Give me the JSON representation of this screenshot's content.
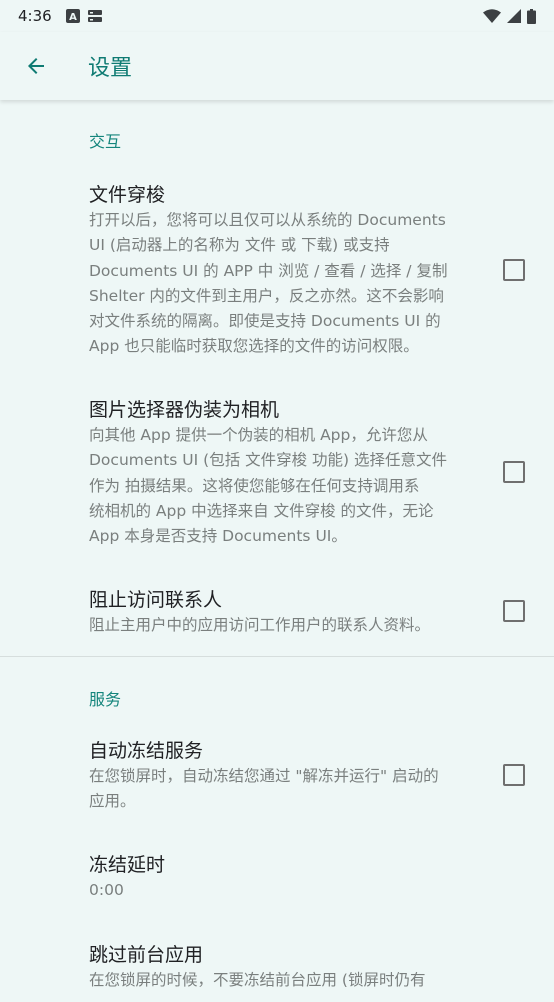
{
  "status_bar": {
    "time": "4:36",
    "icons": [
      "a-icon",
      "sim-card-icon",
      "wifi-icon",
      "signal-icon",
      "battery-icon"
    ]
  },
  "app_bar": {
    "back_icon": "arrow-left-icon",
    "title": "设置"
  },
  "colors": {
    "accent": "#14857c",
    "background": "#eef7f6"
  },
  "sections": [
    {
      "header": "交互",
      "items": [
        {
          "title": "文件穿梭",
          "summary_lines": [
            "打开以后，您将可以且仅可以从系统的 Documents",
            "UI (启动器上的名称为 文件 或 下载) 或支持",
            "Documents UI 的 APP 中 浏览 / 查看 / 选择 / 复制",
            "Shelter 内的文件到主用户，反之亦然。这不会影响",
            "对文件系统的隔离。即使是支持 Documents UI 的",
            "App 也只能临时获取您选择的文件的访问权限。"
          ],
          "checked": false
        },
        {
          "title": "图片选择器伪装为相机",
          "summary_lines": [
            "向其他 App 提供一个伪装的相机 App，允许您从",
            "Documents UI (包括 文件穿梭 功能) 选择任意文件",
            "作为 拍摄结果。这将使您能够在任何支持调用系",
            "统相机的 App 中选择来自 文件穿梭 的文件，无论",
            "App 本身是否支持 Documents UI。"
          ],
          "checked": false
        },
        {
          "title": "阻止访问联系人",
          "summary_lines": [
            "阻止主用户中的应用访问工作用户的联系人资料。"
          ],
          "checked": false
        }
      ]
    },
    {
      "header": "服务",
      "items": [
        {
          "title": "自动冻结服务",
          "summary_lines": [
            "在您锁屏时，自动冻结您通过 \"解冻并运行\" 启动的",
            "应用。"
          ],
          "checked": false
        },
        {
          "title": "冻结延时",
          "summary_lines": [
            "0:00"
          ]
        },
        {
          "title": "跳过前台应用",
          "summary_lines": [
            "在您锁屏的时候，不要冻结前台应用 (锁屏时仍有"
          ]
        }
      ]
    }
  ]
}
